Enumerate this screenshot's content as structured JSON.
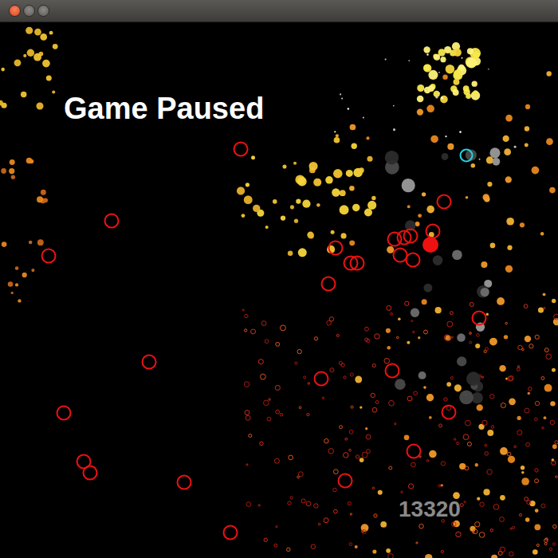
{
  "game": {
    "status": "Game Paused",
    "paused": true,
    "score": "13320"
  }
}
